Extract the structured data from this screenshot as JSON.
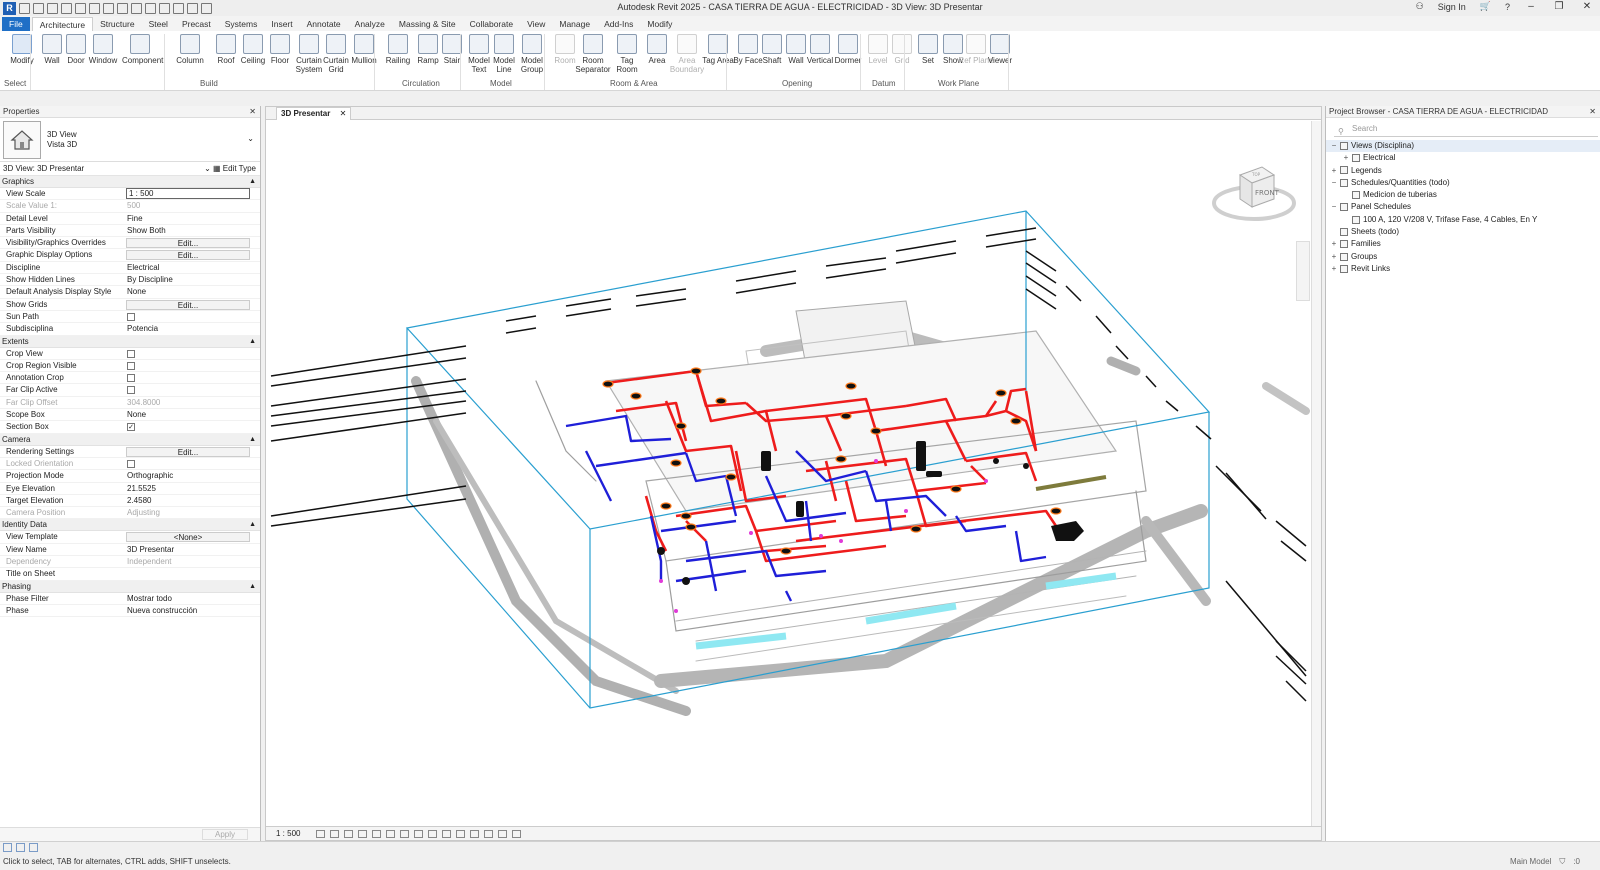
{
  "window": {
    "title": "Autodesk Revit 2025 - CASA TIERRA DE AGUA - ELECTRICIDAD - 3D View: 3D Presentar",
    "sign_in": "Sign In",
    "help": "?"
  },
  "ribbon_tabs": [
    "File",
    "Architecture",
    "Structure",
    "Steel",
    "Precast",
    "Systems",
    "Insert",
    "Annotate",
    "Analyze",
    "Massing & Site",
    "Collaborate",
    "View",
    "Manage",
    "Add-Ins",
    "Modify"
  ],
  "ribbon": {
    "buttons": [
      {
        "label": "Modify",
        "icon": "cursor-icon"
      },
      {
        "label": "Wall",
        "icon": "wall-icon"
      },
      {
        "label": "Door",
        "icon": "door-icon"
      },
      {
        "label": "Window",
        "icon": "window-icon"
      },
      {
        "label": "Component",
        "icon": "component-icon"
      },
      {
        "label": "Column",
        "icon": "column-icon"
      },
      {
        "label": "Roof",
        "icon": "roof-icon"
      },
      {
        "label": "Ceiling",
        "icon": "ceiling-icon"
      },
      {
        "label": "Floor",
        "icon": "floor-icon"
      },
      {
        "label": "Curtain System",
        "icon": "curtain-system-icon"
      },
      {
        "label": "Curtain Grid",
        "icon": "curtain-grid-icon"
      },
      {
        "label": "Mullion",
        "icon": "mullion-icon"
      },
      {
        "label": "Railing",
        "icon": "railing-icon"
      },
      {
        "label": "Ramp",
        "icon": "ramp-icon"
      },
      {
        "label": "Stair",
        "icon": "stair-icon"
      },
      {
        "label": "Model Text",
        "icon": "model-text-icon"
      },
      {
        "label": "Model Line",
        "icon": "model-line-icon"
      },
      {
        "label": "Model Group",
        "icon": "model-group-icon"
      },
      {
        "label": "Room",
        "icon": "room-icon"
      },
      {
        "label": "Room Separator",
        "icon": "room-separator-icon"
      },
      {
        "label": "Tag Room",
        "icon": "tag-room-icon"
      },
      {
        "label": "Area",
        "icon": "area-icon"
      },
      {
        "label": "Area Boundary",
        "icon": "area-boundary-icon"
      },
      {
        "label": "Tag Area",
        "icon": "tag-area-icon"
      },
      {
        "label": "By Face",
        "icon": "by-face-icon"
      },
      {
        "label": "Shaft",
        "icon": "shaft-icon"
      },
      {
        "label": "Wall",
        "icon": "wall-opening-icon"
      },
      {
        "label": "Vertical",
        "icon": "vertical-icon"
      },
      {
        "label": "Dormer",
        "icon": "dormer-icon"
      },
      {
        "label": "Level",
        "icon": "level-icon"
      },
      {
        "label": "Grid",
        "icon": "grid-icon"
      },
      {
        "label": "Set",
        "icon": "set-icon"
      },
      {
        "label": "Show",
        "icon": "show-icon"
      },
      {
        "label": "Ref Plane",
        "icon": "ref-plane-icon"
      },
      {
        "label": "Viewer",
        "icon": "viewer-icon"
      }
    ],
    "panels": [
      "Select",
      "Build",
      "Circulation",
      "Model",
      "Room & Area",
      "Opening",
      "Datum",
      "Work Plane"
    ]
  },
  "properties": {
    "title": "Properties",
    "type_name": "3D View",
    "type_sub": "Vista 3D",
    "instance": "3D View: 3D Presentar",
    "edit_type": "Edit Type",
    "groups": [
      {
        "name": "Graphics",
        "rows": [
          {
            "n": "View Scale",
            "v": "1 : 500",
            "kind": "input"
          },
          {
            "n": "Scale Value    1:",
            "v": "500",
            "kind": "dis"
          },
          {
            "n": "Detail Level",
            "v": "Fine"
          },
          {
            "n": "Parts Visibility",
            "v": "Show Both"
          },
          {
            "n": "Visibility/Graphics Overrides",
            "v": "Edit...",
            "kind": "btn"
          },
          {
            "n": "Graphic Display Options",
            "v": "Edit...",
            "kind": "btn"
          },
          {
            "n": "Discipline",
            "v": "Electrical"
          },
          {
            "n": "Show Hidden Lines",
            "v": "By Discipline"
          },
          {
            "n": "Default Analysis Display Style",
            "v": "None"
          },
          {
            "n": "Show Grids",
            "v": "Edit...",
            "kind": "btn"
          },
          {
            "n": "Sun Path",
            "v": "",
            "kind": "cb"
          },
          {
            "n": "Subdisciplina",
            "v": "Potencia"
          }
        ]
      },
      {
        "name": "Extents",
        "rows": [
          {
            "n": "Crop View",
            "v": "",
            "kind": "cb"
          },
          {
            "n": "Crop Region Visible",
            "v": "",
            "kind": "cb"
          },
          {
            "n": "Annotation Crop",
            "v": "",
            "kind": "cb"
          },
          {
            "n": "Far Clip Active",
            "v": "",
            "kind": "cb"
          },
          {
            "n": "Far Clip Offset",
            "v": "304.8000",
            "kind": "dis"
          },
          {
            "n": "Scope Box",
            "v": "None"
          },
          {
            "n": "Section Box",
            "v": "✓",
            "kind": "cb"
          }
        ]
      },
      {
        "name": "Camera",
        "rows": [
          {
            "n": "Rendering Settings",
            "v": "Edit...",
            "kind": "btn"
          },
          {
            "n": "Locked Orientation",
            "v": "",
            "kind": "cbdis"
          },
          {
            "n": "Projection Mode",
            "v": "Orthographic"
          },
          {
            "n": "Eye Elevation",
            "v": "21.5525"
          },
          {
            "n": "Target Elevation",
            "v": "2.4580"
          },
          {
            "n": "Camera Position",
            "v": "Adjusting",
            "kind": "dis"
          }
        ]
      },
      {
        "name": "Identity Data",
        "rows": [
          {
            "n": "View Template",
            "v": "<None>",
            "kind": "btn"
          },
          {
            "n": "View Name",
            "v": "3D Presentar"
          },
          {
            "n": "Dependency",
            "v": "Independent",
            "kind": "dis"
          },
          {
            "n": "Title on Sheet",
            "v": ""
          }
        ]
      },
      {
        "name": "Phasing",
        "rows": [
          {
            "n": "Phase Filter",
            "v": "Mostrar todo"
          },
          {
            "n": "Phase",
            "v": "Nueva construcción"
          }
        ]
      }
    ],
    "apply": "Apply"
  },
  "view": {
    "tab": "3D Presentar",
    "scale": "1 : 500",
    "viewcube_face": "FRONT",
    "viewcube_top": "TOP"
  },
  "browser": {
    "title": "Project Browser - CASA TIERRA DE AGUA - ELECTRICIDAD",
    "search_placeholder": "Search",
    "items": [
      {
        "label": "Views (Disciplina)",
        "level": 0,
        "toggle": "−",
        "selected": true
      },
      {
        "label": "Electrical",
        "level": 1,
        "toggle": "+"
      },
      {
        "label": "Legends",
        "level": 0,
        "toggle": "+"
      },
      {
        "label": "Schedules/Quantities (todo)",
        "level": 0,
        "toggle": "−"
      },
      {
        "label": "Medicion de tuberias",
        "level": 1,
        "toggle": ""
      },
      {
        "label": "Panel Schedules",
        "level": 0,
        "toggle": "−"
      },
      {
        "label": "100 A, 120 V/208 V, Trifase Fase, 4 Cables, En Y",
        "level": 1,
        "toggle": ""
      },
      {
        "label": "Sheets (todo)",
        "level": 0,
        "toggle": ""
      },
      {
        "label": "Families",
        "level": 0,
        "toggle": "+"
      },
      {
        "label": "Groups",
        "level": 0,
        "toggle": "+"
      },
      {
        "label": "Revit Links",
        "level": 0,
        "toggle": "+"
      }
    ]
  },
  "status": {
    "hint": "Click to select, TAB for alternates, CTRL adds, SHIFT unselects.",
    "model": "Main Model",
    "filter_count": ":0"
  },
  "colors": {
    "section_box": "#2a9fd0",
    "power_conduit": "#ee1c1c",
    "lighting_conduit": "#1f1fd8",
    "building": "#9a9a9a",
    "accent": "#1f6fc6"
  }
}
